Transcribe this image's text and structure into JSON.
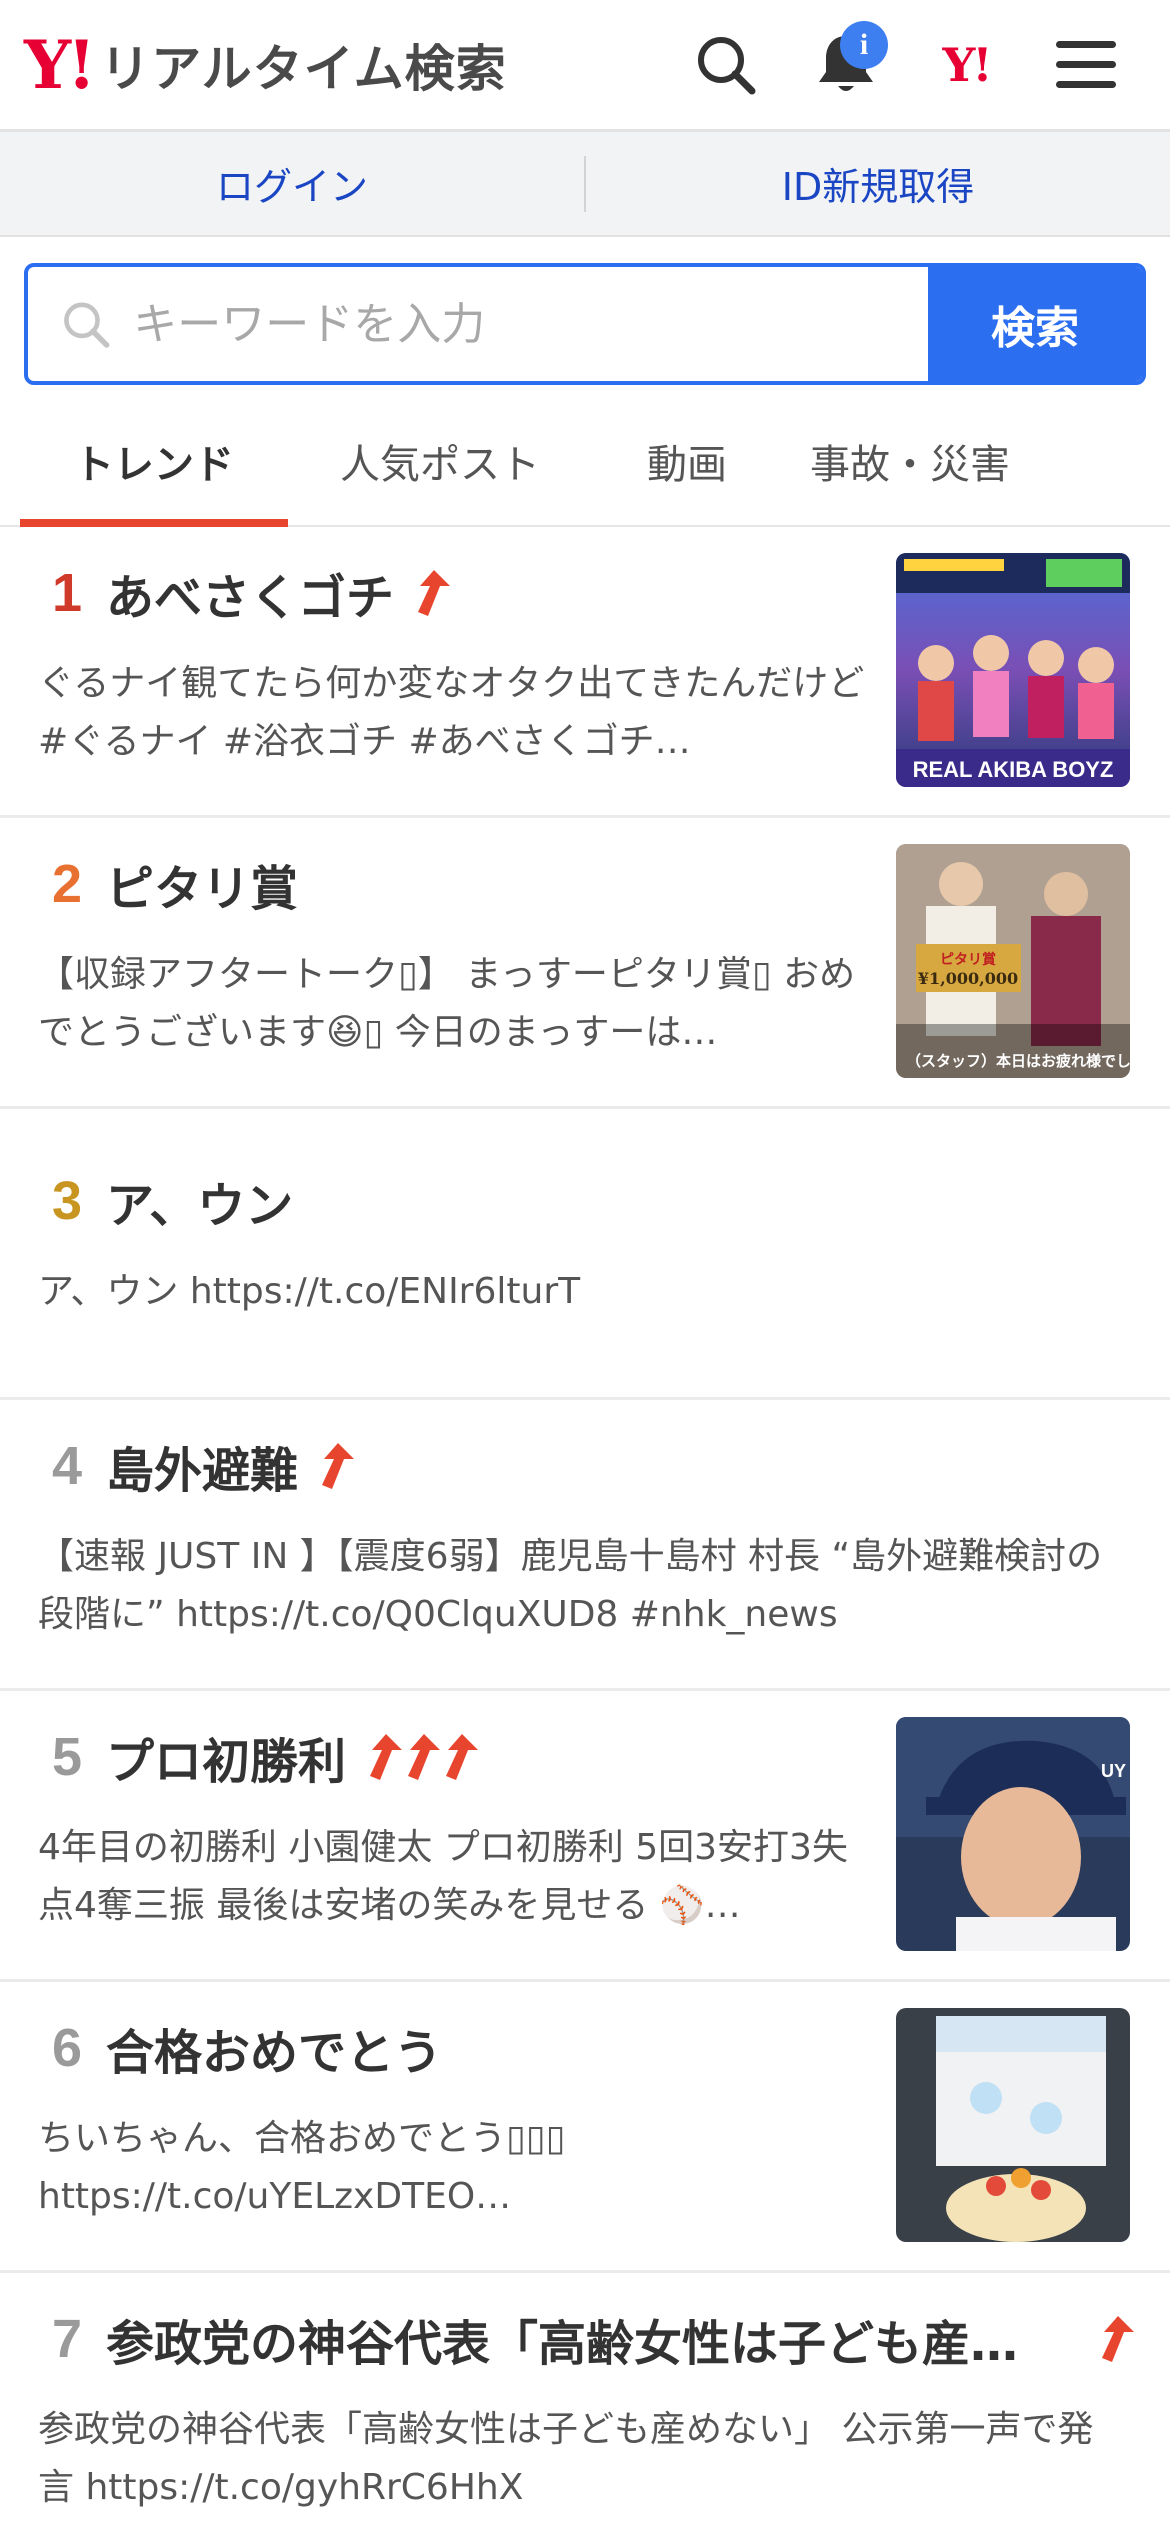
{
  "header": {
    "logo_mark": "Y!",
    "logo_text": "リアルタイム検索",
    "notification_badge": "i",
    "yahoo_small": "Y!"
  },
  "auth": {
    "login": "ログイン",
    "signup": "ID新規取得"
  },
  "search": {
    "placeholder": "キーワードを入力",
    "button": "検索"
  },
  "tabs": [
    "トレンド",
    "人気ポスト",
    "動画",
    "事故・災害"
  ],
  "trends": [
    {
      "rank": "1",
      "title": "あべさくゴチ",
      "desc": "ぐるナイ観てたら何か変なオタク出てきたんだけど #ぐるナイ #浴衣ゴチ #あべさくゴチ…",
      "arrows": 1,
      "thumb_caption": "REAL AKIBA BOYZ"
    },
    {
      "rank": "2",
      "title": "ピタリ賞",
      "desc": "【収録アフタートーク▯】 まっすーピタリ賞▯ おめでとうございます😆▯ 今日のまっすーは…",
      "arrows": 0,
      "thumb_caption": "（スタッフ）本日はお疲れ様でした!"
    },
    {
      "rank": "3",
      "title": "ア、ウン",
      "desc": "ア、ウン https://t.co/ENIr6lturT",
      "arrows": 0
    },
    {
      "rank": "4",
      "title": "島外避難",
      "desc": "【速報 JUST IN 】【震度6弱】鹿児島十島村 村長 “島外避難検討の段階に” https://t.co/Q0ClquXUD8 #nhk_news",
      "arrows": 1
    },
    {
      "rank": "5",
      "title": "プロ初勝利",
      "desc": "4年目の初勝利 小園健太 プロ初勝利 5回3安打3失点4奪三振 最後は安堵の笑みを見せる ⚾…",
      "arrows": 3
    },
    {
      "rank": "6",
      "title": "合格おめでとう",
      "desc": "ちいちゃん、合格おめでとう▯▯▯ https://t.co/uYELzxDTEO…",
      "arrows": 0
    },
    {
      "rank": "7",
      "title": "参政党の神谷代表「高齢女性は子ども産…",
      "desc": "参政党の神谷代表「高齢女性は子ども産めない」 公示第一声で発言 https://t.co/gyhRrC6HhX",
      "arrows": 1
    }
  ],
  "colors": {
    "accent": "#2b6ff0",
    "brand_red": "#e60033",
    "tab_underline": "#e8452f"
  }
}
